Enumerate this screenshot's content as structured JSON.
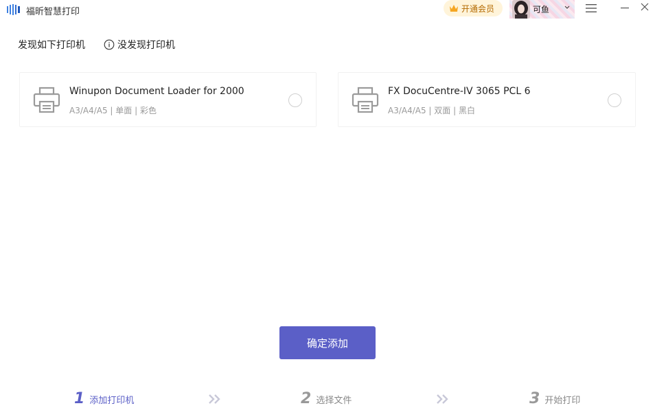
{
  "app": {
    "title": "福昕智慧打印",
    "vip_label": "开通会员",
    "username": "可鱼"
  },
  "tabs": {
    "found": "发现如下打印机",
    "not_found": "没发现打印机"
  },
  "printers": [
    {
      "name": "Winupon Document Loader for 2000",
      "specs": "A3/A4/A5 | 单面 | 彩色",
      "selected": false
    },
    {
      "name": "FX DocuCentre-IV 3065 PCL 6",
      "specs": "A3/A4/A5 | 双面 | 黑白",
      "selected": false
    }
  ],
  "confirm_label": "确定添加",
  "steps": [
    {
      "num": "1",
      "label": "添加打印机",
      "active": true
    },
    {
      "num": "2",
      "label": "选择文件",
      "active": false
    },
    {
      "num": "3",
      "label": "开始打印",
      "active": false
    }
  ],
  "colors": {
    "accent": "#5b5fc7",
    "vip_bg": "#fff4da",
    "vip_text": "#b46a00",
    "muted": "#999999"
  },
  "icons": [
    "app-logo-icon",
    "crown-icon",
    "avatar",
    "chevron-down-icon",
    "menu-icon",
    "minimize-icon",
    "close-icon",
    "info-icon",
    "printer-icon",
    "double-chevron-right-icon"
  ]
}
